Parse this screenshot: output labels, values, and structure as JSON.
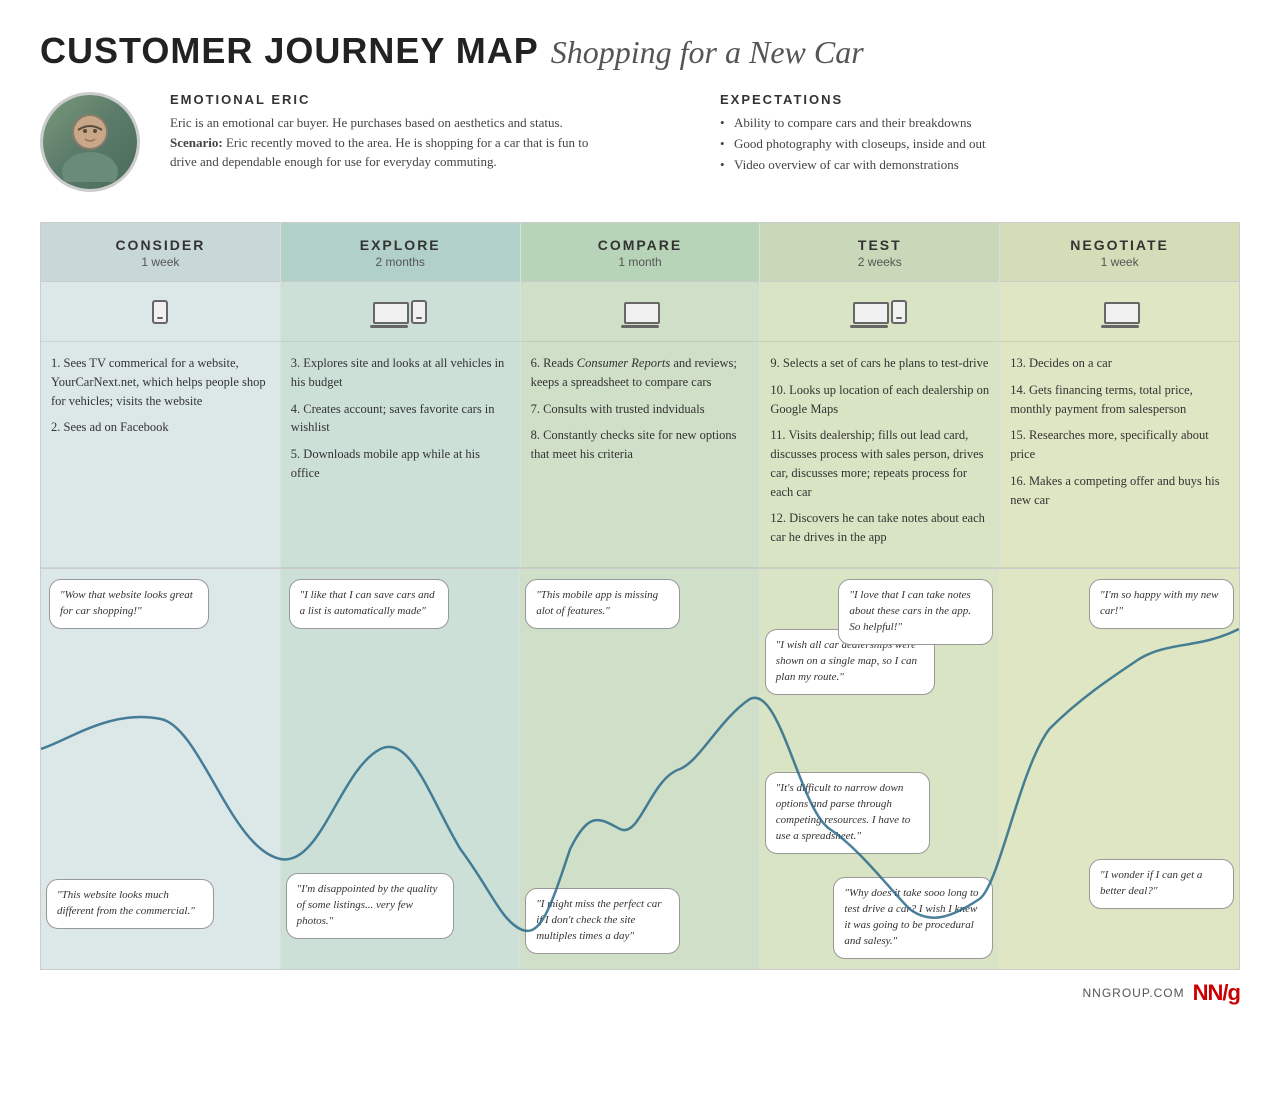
{
  "title": {
    "bold": "CUSTOMER JOURNEY MAP",
    "italic": "Shopping for a New Car"
  },
  "persona": {
    "name": "EMOTIONAL ERIC",
    "description": "Eric is an emotional car buyer. He purchases based on aesthetics and status.",
    "scenario": "Eric recently moved to the area. He is shopping for a car that is fun to drive and dependable enough for use for everyday commuting.",
    "avatar_emoji": "👤"
  },
  "expectations": {
    "title": "EXPECTATIONS",
    "items": [
      "Ability to compare cars and their breakdowns",
      "Good photography with closeups, inside and out",
      "Video overview of car with demonstrations"
    ]
  },
  "phases": [
    {
      "id": "consider",
      "name": "CONSIDER",
      "duration": "1 week",
      "devices": [
        "phone"
      ],
      "actions": [
        "1. Sees TV commerical for a website, YourCarNext.net, which helps people shop for vehicles; visits the website",
        "2. Sees ad on Facebook"
      ]
    },
    {
      "id": "explore",
      "name": "EXPLORE",
      "duration": "2 months",
      "devices": [
        "laptop",
        "phone"
      ],
      "actions": [
        "3. Explores site and looks at all vehicles in his budget",
        "4. Creates account; saves favorite cars in wishlist",
        "5. Downloads mobile app while at his office"
      ]
    },
    {
      "id": "compare",
      "name": "COMPARE",
      "duration": "1 month",
      "devices": [
        "laptop"
      ],
      "actions": [
        "6. Reads Consumer Reports and reviews; keeps a spreadsheet to compare cars",
        "7. Consults with trusted indviduals",
        "8. Constantly checks site for new options that meet his criteria"
      ]
    },
    {
      "id": "test",
      "name": "TEST",
      "duration": "2 weeks",
      "devices": [
        "laptop",
        "phone"
      ],
      "actions": [
        "9. Selects a set of cars he plans to test-drive",
        "10. Looks up location of each dealership on Google Maps",
        "11. Visits dealership; fills out lead card, discusses process with sales person, drives car, discusses more; repeats process for each car",
        "12. Discovers he can take notes about each car he drives in the app"
      ]
    },
    {
      "id": "negotiate",
      "name": "NEGOTIATE",
      "duration": "1 week",
      "devices": [
        "laptop"
      ],
      "actions": [
        "13. Decides on a car",
        "14. Gets financing terms, total price, monthly payment from salesperson",
        "15. Researches more, specifically about price",
        "16. Makes a competing offer and buys his new car"
      ]
    }
  ],
  "emotion_bubbles": {
    "consider": [
      {
        "text": "\"Wow that website looks great for car shopping!\"",
        "valence": "positive"
      },
      {
        "text": "\"This website looks much different from the commercial.\"",
        "valence": "negative"
      }
    ],
    "explore": [
      {
        "text": "\"I like that I can save cars and a list is automatically made\"",
        "valence": "positive"
      },
      {
        "text": "\"I'm disappointed by the quality of some listings... very few photos.\"",
        "valence": "negative"
      }
    ],
    "compare": [
      {
        "text": "\"This mobile app is missing alot of features.\"",
        "valence": "negative"
      },
      {
        "text": "\"I might miss the perfect car if I don't check the site multiples times a day\"",
        "valence": "negative"
      }
    ],
    "test": [
      {
        "text": "\"I wish all car dealerships were shown on a single map, so I can plan my route.\"",
        "valence": "mixed"
      },
      {
        "text": "\"I love that I can take notes about these cars in the app. So helpful!\"",
        "valence": "positive"
      },
      {
        "text": "\"It's difficult to narrow down options and parse through competing resources. I have to use a spreadsheet.\"",
        "valence": "negative"
      },
      {
        "text": "\"Why does it take sooo long to test drive a car? I wish I knew it was going to be procedural and salesy.\"",
        "valence": "negative"
      }
    ],
    "negotiate": [
      {
        "text": "\"I'm so happy with my new car!\"",
        "valence": "positive"
      },
      {
        "text": "\"I wonder if I can get a better deal?\"",
        "valence": "mixed"
      }
    ]
  },
  "footer": {
    "url": "NNGROUP.COM",
    "logo": "NN/g"
  }
}
